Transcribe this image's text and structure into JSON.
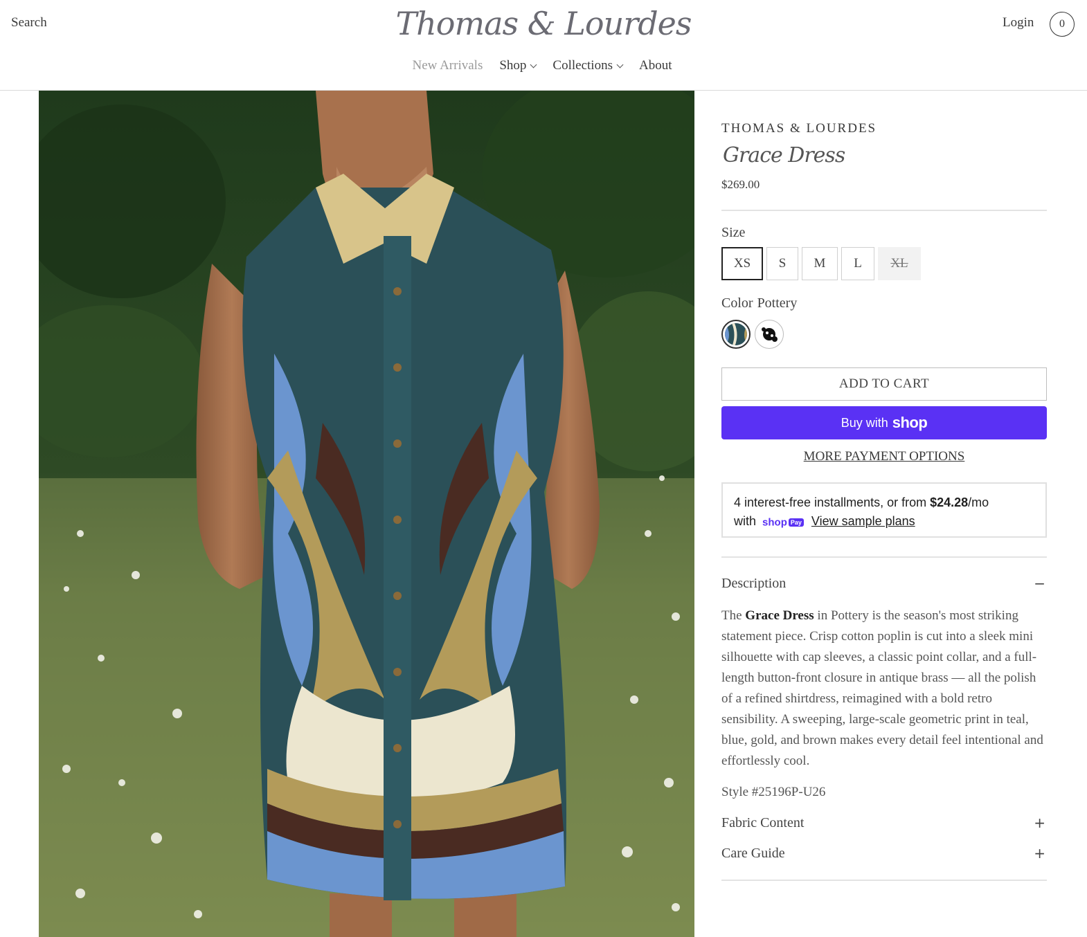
{
  "header": {
    "search_label": "Search",
    "logo_text": "Thomas & Lourdes",
    "login_label": "Login",
    "cart_count": "0"
  },
  "nav": {
    "items": [
      {
        "label": "New Arrivals",
        "has_dropdown": false
      },
      {
        "label": "Shop",
        "has_dropdown": true
      },
      {
        "label": "Collections",
        "has_dropdown": true
      },
      {
        "label": "About",
        "has_dropdown": false
      }
    ]
  },
  "product": {
    "brand": "THOMAS & LOURDES",
    "title": "Grace Dress",
    "price": "$269.00",
    "size_label": "Size",
    "sizes": [
      {
        "label": "XS",
        "selected": true,
        "available": true
      },
      {
        "label": "S",
        "selected": false,
        "available": true
      },
      {
        "label": "M",
        "selected": false,
        "available": true
      },
      {
        "label": "L",
        "selected": false,
        "available": true
      },
      {
        "label": "XL",
        "selected": false,
        "available": false
      }
    ],
    "color_label": "Color",
    "color_value": "Pottery",
    "add_to_cart": "ADD TO CART",
    "buy_with": "Buy with",
    "buy_with_brand": "shop",
    "more_payment": "MORE PAYMENT OPTIONS",
    "installments": {
      "line1_pre": "4 interest-free installments, or from ",
      "amount": "$24.28",
      "line1_post": "/mo",
      "line2_pre": "with",
      "badge": "shop",
      "badge_pay": "Pay",
      "link": "View sample plans"
    },
    "description_heading": "Description",
    "description_pre": "The ",
    "description_bold": "Grace Dress",
    "description_post": " in Pottery is the season's most striking statement piece. Crisp cotton poplin is cut into a sleek mini silhouette with cap sleeves, a classic point collar, and a full-length button-front closure in antique brass — all the polish of a refined shirtdress, reimagined with a bold retro sensibility. A sweeping, large-scale geometric print in teal, blue, gold, and brown makes every detail feel intentional and effortlessly cool.",
    "style_number": "Style #25196P-U26",
    "fabric_heading": "Fabric Content",
    "care_heading": "Care Guide",
    "minus_sign": "−",
    "plus_sign": "+"
  },
  "colors": {
    "shop_pay_purple": "#5a31f4",
    "text_dark": "#3a3a3a"
  }
}
